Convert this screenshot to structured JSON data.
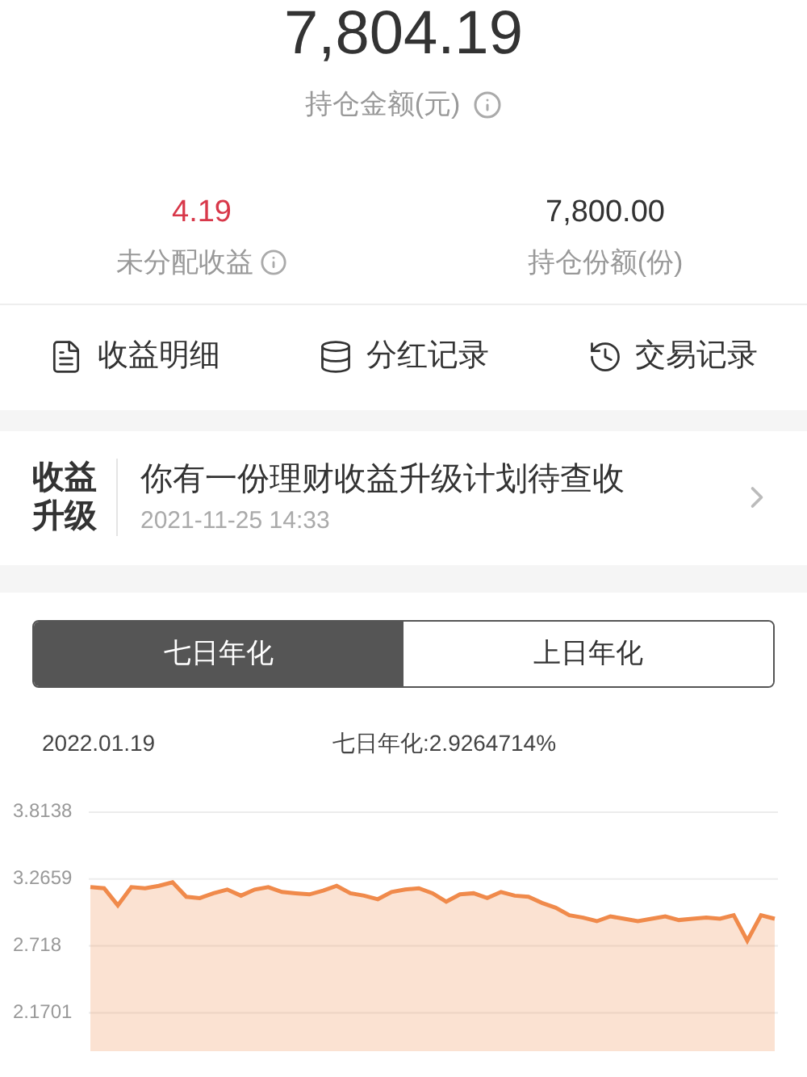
{
  "holding": {
    "amount": "7,804.19",
    "label": "持仓金额(元)"
  },
  "stats": [
    {
      "value": "4.19",
      "label": "未分配收益",
      "kind": "income"
    },
    {
      "value": "7,800.00",
      "label": "持仓份额(份)",
      "kind": "shares"
    }
  ],
  "actions": [
    {
      "label": "收益明细",
      "kind": "detail"
    },
    {
      "label": "分红记录",
      "kind": "dividend"
    },
    {
      "label": "交易记录",
      "kind": "history"
    }
  ],
  "notice": {
    "logo_lines": [
      "收益",
      "升级"
    ],
    "title": "你有一份理财收益升级计划待查收",
    "time": "2021-11-25 14:33"
  },
  "tabs": [
    {
      "label": "七日年化",
      "selected": true
    },
    {
      "label": "上日年化",
      "selected": false
    }
  ],
  "chart_header": {
    "date": "2022.01.19",
    "reading": "七日年化:2.9264714%"
  },
  "chart_data": {
    "type": "area",
    "ylim": [
      1.855,
      3.8138
    ],
    "grid": true,
    "yticks": [
      {
        "value": 3.8138,
        "label": "3.8138"
      },
      {
        "value": 3.2659,
        "label": "3.2659"
      },
      {
        "value": 2.718,
        "label": "2.718"
      },
      {
        "value": 2.1701,
        "label": "2.1701"
      }
    ],
    "series": [
      {
        "color": "#f08a4b",
        "values": [
          3.2,
          3.19,
          3.05,
          3.2,
          3.19,
          3.21,
          3.24,
          3.12,
          3.11,
          3.15,
          3.18,
          3.13,
          3.18,
          3.2,
          3.16,
          3.15,
          3.14,
          3.17,
          3.21,
          3.15,
          3.13,
          3.1,
          3.16,
          3.18,
          3.19,
          3.15,
          3.08,
          3.14,
          3.15,
          3.11,
          3.16,
          3.13,
          3.12,
          3.07,
          3.03,
          2.97,
          2.95,
          2.92,
          2.96,
          2.94,
          2.92,
          2.94,
          2.96,
          2.93,
          2.94,
          2.95,
          2.94,
          2.97,
          2.76,
          2.97,
          2.94
        ]
      }
    ]
  }
}
